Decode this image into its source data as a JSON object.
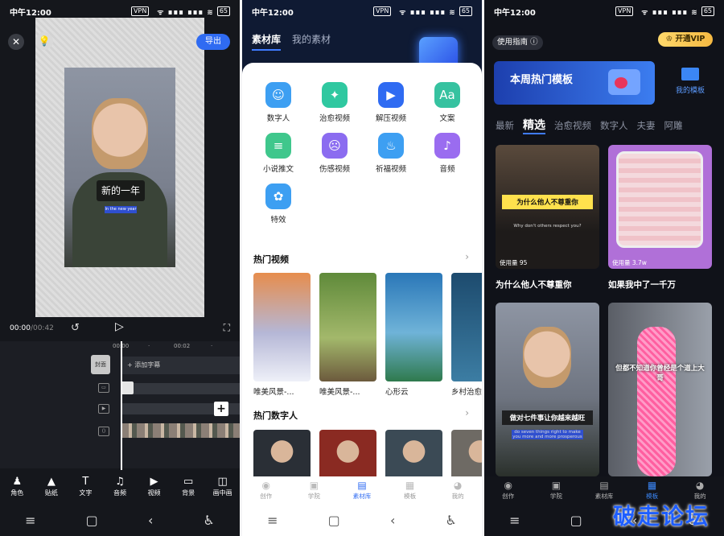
{
  "status_bar": {
    "time": "中午12:00",
    "vpn": "VPN",
    "battery": "65",
    "signal": "ᯤ ∎∎∎ ∎∎∎ ≋"
  },
  "editor": {
    "export_label": "导出",
    "caption_main": "新的一年",
    "caption_sub": "In the new year",
    "time_current": "00:00",
    "time_total": "/00:42",
    "ruler_ticks": [
      "00:00",
      "·",
      "00:02",
      "·"
    ],
    "cover_label": "封面",
    "add_subtitle": "+ 添加字幕",
    "tools": [
      {
        "icon": "person-icon",
        "glyph": "♟",
        "label": "角色"
      },
      {
        "icon": "sticker-icon",
        "glyph": "▲",
        "label": "贴纸"
      },
      {
        "icon": "text-icon",
        "glyph": "T",
        "label": "文字"
      },
      {
        "icon": "music-icon",
        "glyph": "♫",
        "label": "音频"
      },
      {
        "icon": "video-icon",
        "glyph": "▶",
        "label": "视频"
      },
      {
        "icon": "background-icon",
        "glyph": "▭",
        "label": "背景"
      },
      {
        "icon": "pip-icon",
        "glyph": "◫",
        "label": "画中画"
      }
    ]
  },
  "library": {
    "tabs": [
      "素材库",
      "我的素材"
    ],
    "categories": [
      {
        "label": "数字人",
        "color": "#3d9ff2",
        "glyph": "☺"
      },
      {
        "label": "治愈视频",
        "color": "#2fc8a0",
        "glyph": "✦"
      },
      {
        "label": "解压视频",
        "color": "#2f6bf2",
        "glyph": "▶"
      },
      {
        "label": "文案",
        "color": "#36c2a0",
        "glyph": "Aa"
      },
      {
        "label": "小说推文",
        "color": "#3fc78c",
        "glyph": "≡"
      },
      {
        "label": "伤感视频",
        "color": "#8b6cf0",
        "glyph": "☹"
      },
      {
        "label": "祈福视频",
        "color": "#3d9ff2",
        "glyph": "♨"
      },
      {
        "label": "音频",
        "color": "#9a6cf0",
        "glyph": "♪"
      },
      {
        "label": "特效",
        "color": "#3d9ff2",
        "glyph": "✿"
      }
    ],
    "hot_videos_title": "热门视频",
    "hot_videos": [
      {
        "label": "唯美风景-...",
        "color": "linear-gradient(#e78d4d, #b5b7d6 55%, #eef0f8)"
      },
      {
        "label": "唯美风景-...",
        "color": "linear-gradient(#5f8a3a, #a3b86b 60%, #6c5a3d)"
      },
      {
        "label": "心形云",
        "color": "linear-gradient(#2a77b8, #6fb3d8 55%, #2f7a4d)"
      },
      {
        "label": "乡村治愈",
        "color": "linear-gradient(#1d4b6e, #3c7da3)"
      }
    ],
    "hot_digital_title": "热门数字人",
    "digital_colors": [
      "#2a2f36",
      "#8a2a22",
      "#3b4a55",
      "#6e6a64"
    ],
    "bottom_tabs": [
      {
        "icon": "create-icon",
        "glyph": "◉",
        "label": "创作"
      },
      {
        "icon": "learn-icon",
        "glyph": "▣",
        "label": "学院"
      },
      {
        "icon": "library-icon",
        "glyph": "▤",
        "label": "素材库",
        "active": true
      },
      {
        "icon": "template-icon",
        "glyph": "▦",
        "label": "模板"
      },
      {
        "icon": "profile-icon",
        "glyph": "◕",
        "label": "我的"
      }
    ]
  },
  "templates": {
    "guide_label": "使用指南 ⓘ",
    "vip_label": "♔ 开通VIP",
    "banner_title": "本周热门模板",
    "my_templates": "我的模板",
    "categories": [
      "最新",
      "精选",
      "治愈视频",
      "数字人",
      "夫妻",
      "阿雕"
    ],
    "cards": [
      {
        "tag": "为什么他人不尊重你",
        "sub": "Why don't others respect you?",
        "uses": "使用量 95",
        "title": "为什么他人不尊重你"
      },
      {
        "uses": "使用量 3.7w",
        "title": "如果我中了一千万"
      },
      {
        "tag": "做对七件事让你越来越旺",
        "sub": "do seven things right to make you more and more prosperous"
      },
      {
        "tag": "但都不知道你曾经是个道上大哥"
      }
    ],
    "bottom_tabs": [
      {
        "icon": "create-icon",
        "glyph": "◉",
        "label": "创作"
      },
      {
        "icon": "learn-icon",
        "glyph": "▣",
        "label": "学院"
      },
      {
        "icon": "library-icon",
        "glyph": "▤",
        "label": "素材库"
      },
      {
        "icon": "template-icon",
        "glyph": "▦",
        "label": "模板",
        "active": true
      },
      {
        "icon": "profile-icon",
        "glyph": "◕",
        "label": "我的"
      }
    ]
  },
  "system_nav": [
    "≡",
    "▢",
    "‹",
    "♿"
  ],
  "watermark": "破走论坛"
}
